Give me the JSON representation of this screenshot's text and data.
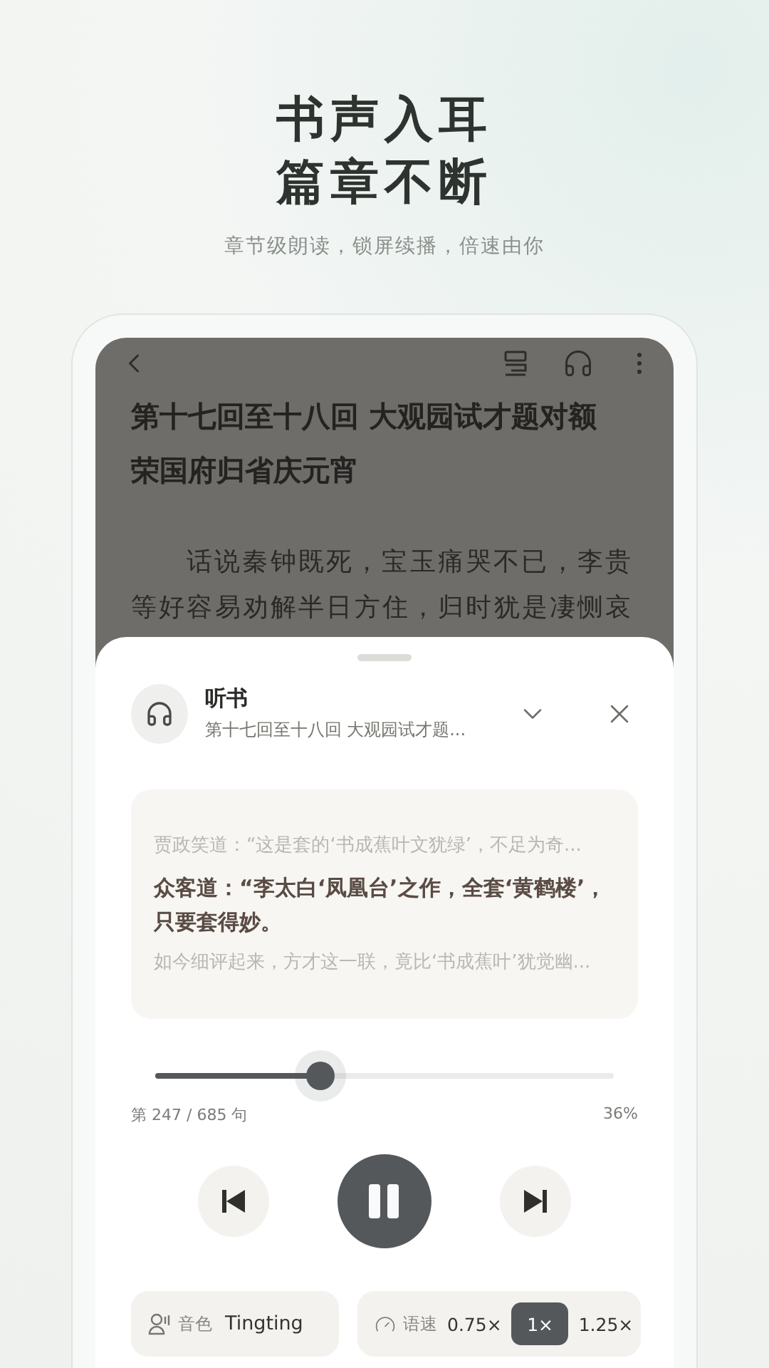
{
  "headline": [
    "书声入耳",
    "篇章不断"
  ],
  "tagline": "章节级朗读，锁屏续播，倍速由你",
  "reader": {
    "title": "第十七回至十八回 大观园试才题对额荣国府归省庆元宵",
    "paragraph": "话说秦钟既死，宝玉痛哭不已，李贵等好容易劝解半日方住，归时犹是凄恻哀"
  },
  "player": {
    "title": "听书",
    "subtitle": "第十七回至十八回 大观园试才题...",
    "lines": [
      {
        "text": "贾政笑道：“这是套的‘书成蕉叶文犹绿’，不足为奇...",
        "current": false
      },
      {
        "text": "众客道：“李太白‘凤凰台’之作，全套‘黄鹤楼’，只要套得妙。",
        "current": true
      },
      {
        "text": "如今细评起来，方才这一联，竟比‘书成蕉叶’犹觉幽...",
        "current": false
      }
    ],
    "progress": {
      "level": 0.36,
      "position": "第 247 / 685 句",
      "percent": "36%"
    },
    "playing": true,
    "voice": {
      "label": "音色",
      "value": "Tingting"
    },
    "speed": {
      "label": "语速",
      "options": [
        {
          "label": "0.75×",
          "selected": false
        },
        {
          "label": "1×",
          "selected": true
        },
        {
          "label": "1.25×",
          "selected": false
        }
      ]
    }
  }
}
